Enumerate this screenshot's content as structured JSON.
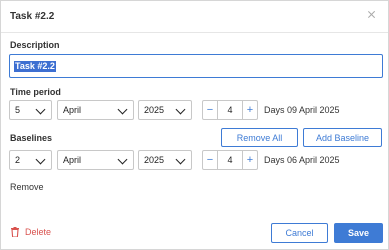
{
  "dialog": {
    "title": "Task #2.2",
    "close_icon": "close-icon"
  },
  "description": {
    "label": "Description",
    "value": "Task #2.2"
  },
  "time_period": {
    "label": "Time period",
    "day": "5",
    "month": "April",
    "year": "2025",
    "duration": "4",
    "minus": "−",
    "plus": "+",
    "days_text": "Days 09 April 2025"
  },
  "baselines": {
    "label": "Baselines",
    "remove_all": "Remove All",
    "add_baseline": "Add Baseline",
    "day": "2",
    "month": "April",
    "year": "2025",
    "duration": "4",
    "minus": "−",
    "plus": "+",
    "days_text": "Days 06 April 2025",
    "remove": "Remove"
  },
  "footer": {
    "delete": "Delete",
    "cancel": "Cancel",
    "save": "Save"
  },
  "colors": {
    "accent": "#3e7bd5",
    "danger": "#d9534f"
  }
}
